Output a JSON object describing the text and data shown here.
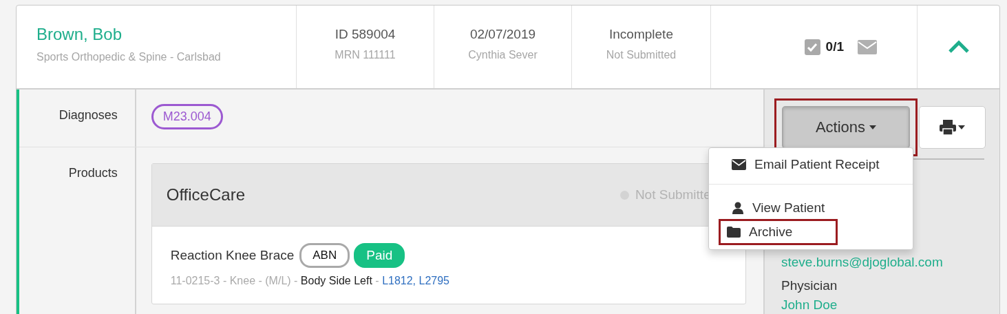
{
  "header": {
    "patient_name": "Brown, Bob",
    "clinic": "Sports Orthopedic & Spine - Carlsbad",
    "id": "ID 589004",
    "mrn": "MRN 111111",
    "date": "02/07/2019",
    "provider": "Cynthia Sever",
    "status": "Incomplete",
    "submission": "Not Submitted",
    "task_count": "0/1",
    "expanded": true
  },
  "rows": [
    {
      "label": "Diagnoses",
      "kind": "diagnoses",
      "codes": [
        {
          "code": "M23.004",
          "color": "#9c59d1"
        }
      ]
    },
    {
      "label": "Products",
      "kind": "products",
      "groups": [
        {
          "name": "OfficeCare",
          "status": "Not Submitte",
          "items": [
            {
              "name": "Reaction Knee Brace",
              "badges": [
                {
                  "label": "ABN",
                  "kind": "outline"
                },
                {
                  "label": "Paid",
                  "kind": "filled"
                }
              ],
              "details": [
                {
                  "text": "11-0215-3 - Knee - (M/L) - ",
                  "kind": "plain"
                },
                {
                  "text": "Body Side Left",
                  "kind": "side"
                },
                {
                  "text": " - ",
                  "kind": "plain"
                },
                {
                  "text": "L1812, L2795",
                  "kind": "code"
                }
              ]
            }
          ]
        }
      ]
    }
  ],
  "side_panel": {
    "actions_button": {
      "label": "Actions",
      "highlighted": true
    },
    "email": "steve.burns@djoglobal.com",
    "physician_label": "Physician",
    "physician": "John Doe"
  },
  "actions_menu": {
    "sections": [
      {
        "items": [
          {
            "label": "Email Patient Receipt",
            "kind": "email",
            "highlighted": false
          }
        ]
      },
      {
        "items": [
          {
            "label": "View Patient",
            "kind": "person",
            "highlighted": false
          },
          {
            "label": "Archive",
            "kind": "folder",
            "highlighted": true
          }
        ]
      }
    ]
  }
}
